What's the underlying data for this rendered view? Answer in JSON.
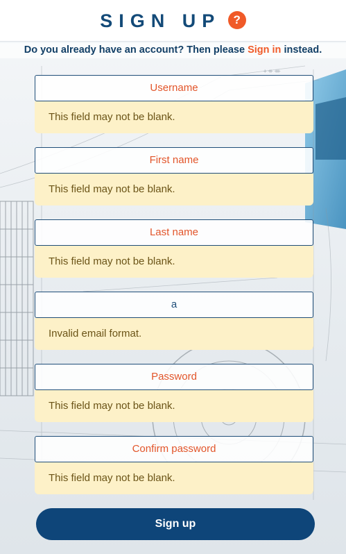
{
  "header": {
    "title": "SIGN UP",
    "help_icon": "?"
  },
  "subline": {
    "before": "Do you already have an account? Then please ",
    "link": "Sign in",
    "after": " instead."
  },
  "fields": [
    {
      "placeholder": "Username",
      "value": "",
      "error": "This field may not be blank."
    },
    {
      "placeholder": "First name",
      "value": "",
      "error": "This field may not be blank."
    },
    {
      "placeholder": "Last name",
      "value": "",
      "error": "This field may not be blank."
    },
    {
      "placeholder": "",
      "value": "a",
      "error": "Invalid email format."
    },
    {
      "placeholder": "Password",
      "value": "",
      "error": "This field may not be blank."
    },
    {
      "placeholder": "Confirm password",
      "value": "",
      "error": "This field may not be blank."
    }
  ],
  "submit": {
    "label": "Sign up"
  },
  "colors": {
    "brand": "#134a78",
    "accent": "#f05a28",
    "error_bg": "#fdf1c8",
    "button_bg": "#0e4579"
  }
}
